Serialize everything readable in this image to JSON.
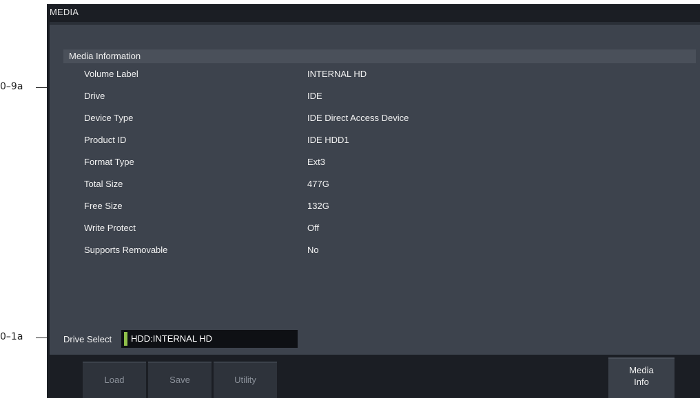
{
  "callouts": {
    "top": "0–9a",
    "bottom": "0–1a"
  },
  "window": {
    "title": "MEDIA"
  },
  "media_information": {
    "header": "Media Information",
    "rows": [
      {
        "label": "Volume Label",
        "value": "INTERNAL HD"
      },
      {
        "label": "Drive",
        "value": "IDE"
      },
      {
        "label": "Device Type",
        "value": "IDE Direct Access Device"
      },
      {
        "label": "Product ID",
        "value": "IDE HDD1"
      },
      {
        "label": "Format Type",
        "value": "Ext3"
      },
      {
        "label": "Total Size",
        "value": "477G"
      },
      {
        "label": "Free Size",
        "value": "132G"
      },
      {
        "label": "Write Protect",
        "value": "Off"
      },
      {
        "label": "Supports Removable",
        "value": "No"
      }
    ]
  },
  "drive_select": {
    "label": "Drive Select",
    "value": "HDD:INTERNAL HD"
  },
  "tabs": {
    "load": "Load",
    "save": "Save",
    "utility": "Utility",
    "media_info_line1": "Media",
    "media_info_line2": "Info"
  },
  "colors": {
    "accent": "#8fbf4a",
    "panel": "#3d434d",
    "background": "#1b1e24"
  }
}
